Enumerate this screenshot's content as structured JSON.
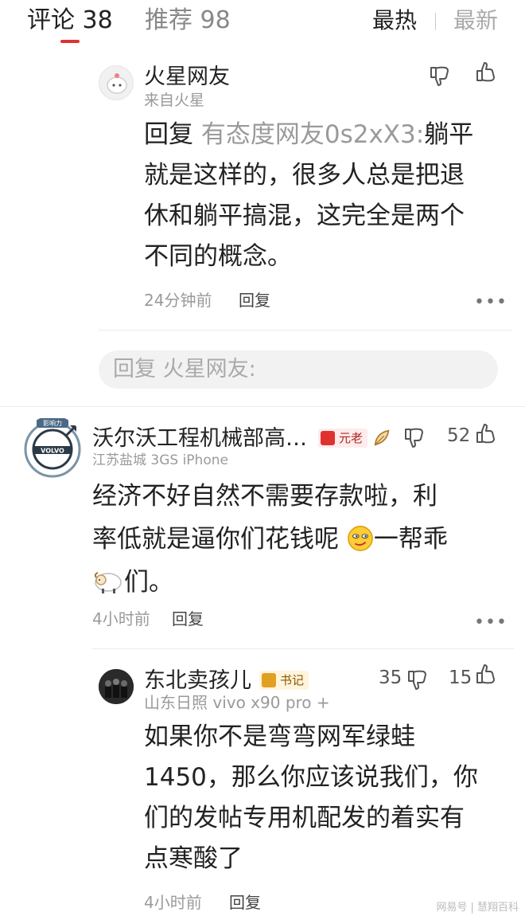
{
  "tabs": {
    "comments_label": "评论 38",
    "recommend_label": "推荐 98",
    "sort_hot": "最热",
    "sort_new": "最新"
  },
  "comment1": {
    "username": "火星网友",
    "location": "来自火星",
    "reply_prefix": "回复",
    "reply_to": "有态度网友0s2xX3:",
    "text_lines": [
      "躺平",
      "就是这样的，很多人总是把退",
      "休和躺平搞混，这完全是两个",
      "不同的概念。"
    ],
    "time": "24分钟前",
    "reply_label": "回复"
  },
  "reply_box": {
    "placeholder": "回复 火星网友:"
  },
  "comment2": {
    "username": "沃尔沃工程机械部高…",
    "badge": "元老",
    "like_count": "52",
    "location": "江苏盐城  3GS  iPhone",
    "avatar_text": "VOLVO",
    "avatar_banner": "影响力",
    "text_lines": [
      "经济不好自然不需要存款啦，利",
      "率低就是逼你们花钱呢",
      "一帮乖",
      "们。"
    ],
    "time": "4小时前",
    "reply_label": "回复"
  },
  "comment3": {
    "username": "东北卖孩儿",
    "badge": "书记",
    "dislike_count": "35",
    "like_count": "15",
    "location": "山东日照  vivo x90 pro +",
    "text_lines": [
      "如果你不是弯弯网军绿蛙",
      "1450，那么你应该说我们，你",
      "们的发帖专用机配发的着实有",
      "点寒酸了"
    ],
    "time": "4小时前",
    "reply_label": "回复"
  },
  "more_label": "•••",
  "watermark": "网易号 | 慧翔百科",
  "colors": {
    "accent": "#e03131",
    "badge_red": "#e03131",
    "badge_gold": "#e0a020"
  }
}
